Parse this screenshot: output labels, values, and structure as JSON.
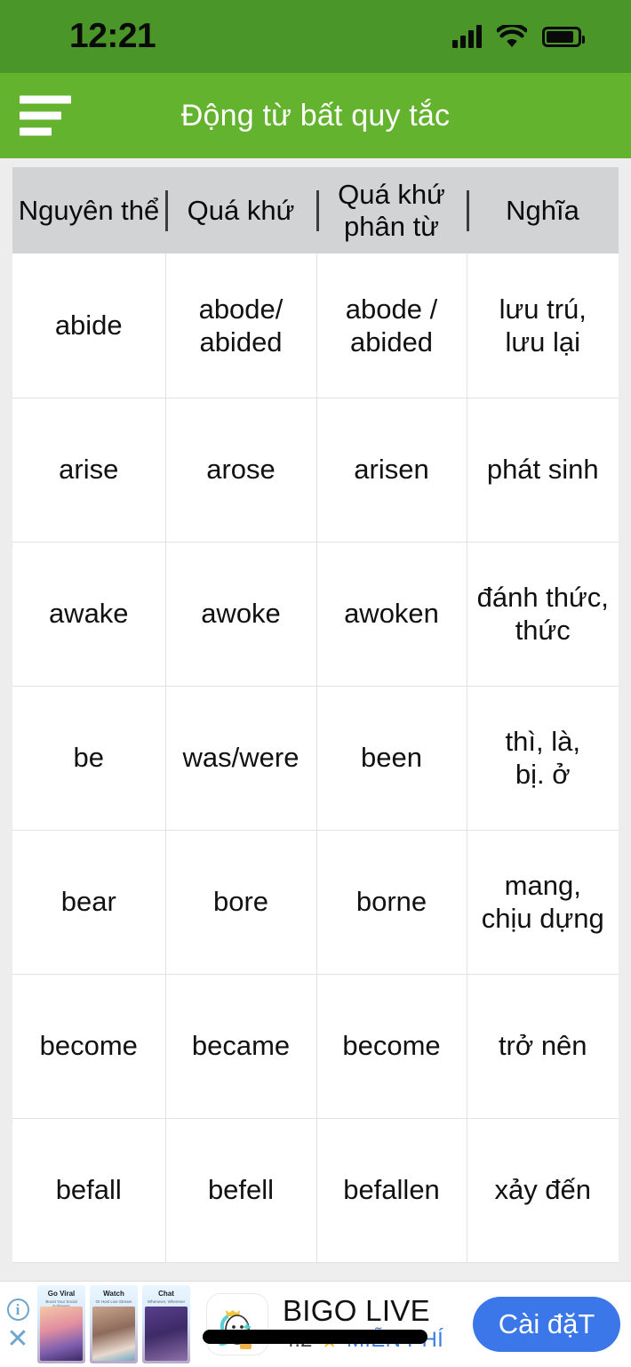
{
  "status_bar": {
    "time": "12:21",
    "signal_icon": "signal-bars-icon",
    "wifi_icon": "wifi-icon",
    "battery_icon": "battery-icon"
  },
  "app_bar": {
    "menu_icon": "hamburger-menu-icon",
    "title": "Động từ bất quy tắc"
  },
  "table": {
    "headers": [
      "Nguyên thể",
      "Quá khứ",
      "Quá khứ phân từ",
      "Nghĩa"
    ],
    "rows": [
      {
        "base": "abide",
        "past": "abode/\nabided",
        "participle": "abode /\nabided",
        "meaning": "lưu trú,\nlưu lại"
      },
      {
        "base": "arise",
        "past": "arose",
        "participle": "arisen",
        "meaning": "phát sinh"
      },
      {
        "base": "awake",
        "past": "awoke",
        "participle": "awoken",
        "meaning": "đánh thức,\nthức"
      },
      {
        "base": "be",
        "past": "was/were",
        "participle": "been",
        "meaning": "thì, là,\nbị. ở"
      },
      {
        "base": "bear",
        "past": "bore",
        "participle": "borne",
        "meaning": "mang,\nchịu dựng"
      },
      {
        "base": "become",
        "past": "became",
        "participle": "become",
        "meaning": "trở nên"
      },
      {
        "base": "befall",
        "past": "befell",
        "participle": "befallen",
        "meaning": "xảy đến"
      }
    ]
  },
  "ad": {
    "info_icon": "info-icon",
    "info_label": "i",
    "close_icon": "close-icon",
    "close_label": "✕",
    "thumbnails": [
      {
        "title": "Go Viral",
        "subtitle": "Boost Your Social Followers"
      },
      {
        "title": "Watch",
        "subtitle": "Or Host Live Stream"
      },
      {
        "title": "Chat",
        "subtitle": "Whenever, Wherever"
      }
    ],
    "app_icon": "bigo-live-app-icon",
    "title": "BIGO LIVE",
    "rating": "4.2",
    "star_icon": "star-icon",
    "star_glyph": "★",
    "price": "MIỄN PHÍ",
    "cta_label": "Cài đặT"
  },
  "colors": {
    "status_bar_green": "#4b9629",
    "app_bar_green": "#64b32e",
    "table_header_gray": "#d2d3d4",
    "cta_blue": "#3b77e8",
    "free_blue": "#3d7fe0",
    "star_gold": "#f3b827"
  }
}
